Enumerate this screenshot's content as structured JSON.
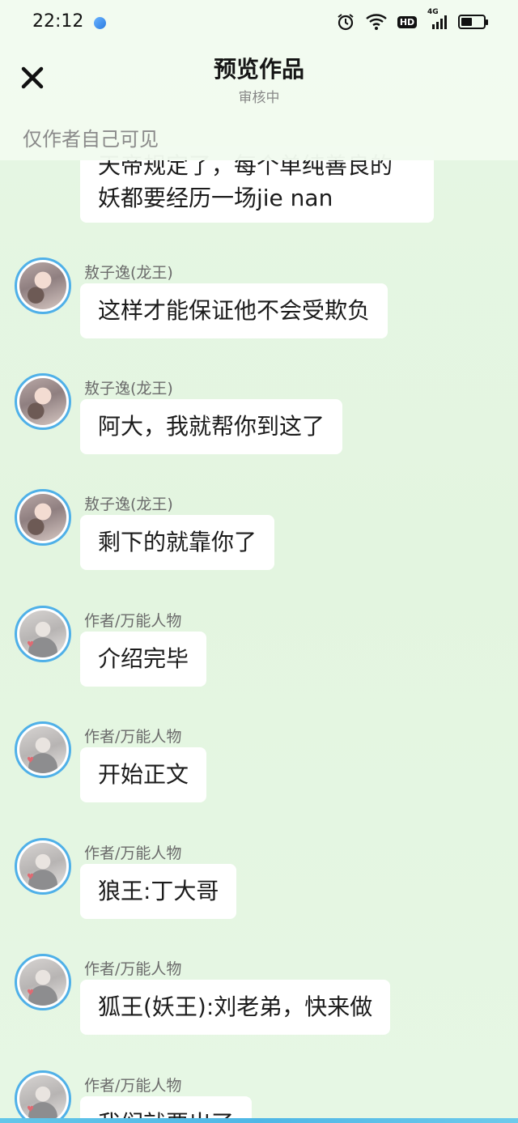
{
  "status_bar": {
    "time": "22:12",
    "hd_label": "HD",
    "network_label": "4G"
  },
  "header": {
    "title": "预览作品",
    "subtitle": "审核中",
    "notice": "仅作者自己可见"
  },
  "top_bubble": {
    "line1": "天帝规定了，每个单纯善良的",
    "line2": "妖都要经历一场jie nan"
  },
  "messages": [
    {
      "sender": "敖子逸(龙王)",
      "text": "这样才能保证他不会受欺负",
      "avatar": "dragon"
    },
    {
      "sender": "敖子逸(龙王)",
      "text": "阿大，我就帮你到这了",
      "avatar": "dragon"
    },
    {
      "sender": "敖子逸(龙王)",
      "text": "剩下的就靠你了",
      "avatar": "dragon"
    },
    {
      "sender": "作者/万能人物",
      "text": "介绍完毕",
      "avatar": "author"
    },
    {
      "sender": "作者/万能人物",
      "text": "开始正文",
      "avatar": "author"
    },
    {
      "sender": "作者/万能人物",
      "text": "狼王:丁大哥",
      "avatar": "author"
    },
    {
      "sender": "作者/万能人物",
      "text": "狐王(妖王):刘老弟，快来做",
      "avatar": "author"
    },
    {
      "sender": "作者/万能人物",
      "text": "我们就要出了",
      "avatar": "author"
    }
  ],
  "colors": {
    "accent": "#4fb0e8",
    "background": "#e4f6e2",
    "bubble": "#ffffff"
  }
}
